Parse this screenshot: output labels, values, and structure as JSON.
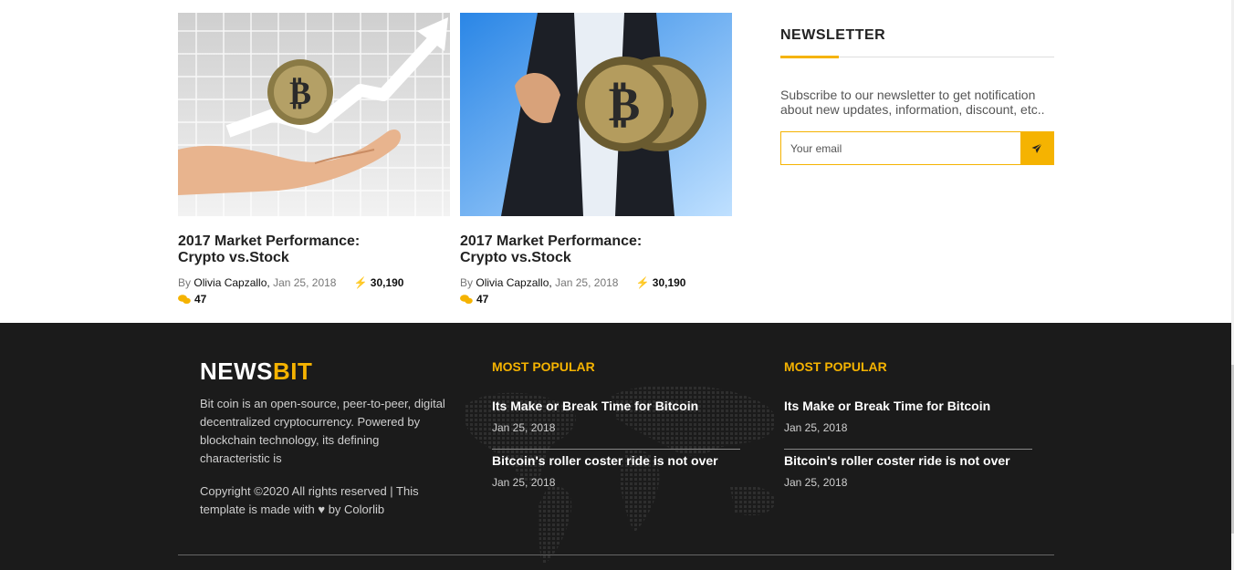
{
  "articles": [
    {
      "title": "2017 Market Performance: Crypto vs.Stock",
      "by": "By",
      "author": "Olivia Capzallo,",
      "date": "Jan 25, 2018",
      "views": "30,190",
      "comments": "47",
      "image": "hand-holding-bitcoin-chart"
    },
    {
      "title": "2017 Market Performance: Crypto vs.Stock",
      "by": "By",
      "author": "Olivia Capzallo,",
      "date": "Jan 25, 2018",
      "views": "30,190",
      "comments": "47",
      "image": "businessman-holding-bitcoins"
    }
  ],
  "newsletter": {
    "title": "NEWSLETTER",
    "text": "Subscribe to our newsletter to get notification about new updates, information, discount, etc..",
    "placeholder": "Your email",
    "submit_icon": "paper-plane-icon"
  },
  "footer": {
    "logo_white": "NEWS",
    "logo_accent": "BIT",
    "about": "Bit coin is an open-source, peer-to-peer, digital decentralized cryptocurrency. Powered by blockchain technology, its defining characteristic is",
    "copyright_prefix": "Copyright ©2020 All rights reserved | This template is made with",
    "copyright_suffix": "by Colorlib",
    "columns": [
      {
        "title": "MOST POPULAR",
        "posts": [
          {
            "title": "Its Make or Break Time for Bitcoin",
            "date": "Jan 25, 2018"
          },
          {
            "title": "Bitcoin's roller coster ride is not over",
            "date": "Jan 25, 2018"
          }
        ]
      },
      {
        "title": "MOST POPULAR",
        "posts": [
          {
            "title": "Its Make or Break Time for Bitcoin",
            "date": "Jan 25, 2018"
          },
          {
            "title": "Bitcoin's roller coster ride is not over",
            "date": "Jan 25, 2018"
          }
        ]
      }
    ]
  },
  "colors": {
    "accent": "#f5b301",
    "footer_bg": "#1b1b1b"
  }
}
